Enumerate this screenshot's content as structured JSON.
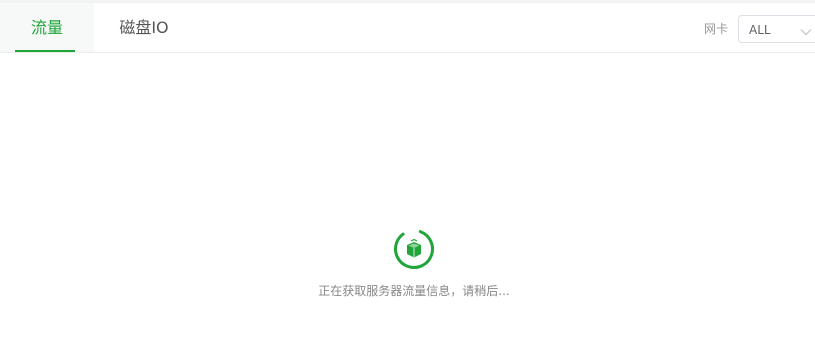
{
  "tabs": [
    {
      "label": "流量",
      "active": true
    },
    {
      "label": "磁盘IO",
      "active": false
    }
  ],
  "nic_filter": {
    "label": "网卡",
    "selected": "ALL",
    "icon": "chevron-down-icon"
  },
  "loading": {
    "icon": "server-loading-icon",
    "message": "正在获取服务器流量信息，请稍后..."
  },
  "colors": {
    "accent": "#20a53a",
    "tab_active_bg": "#f7f8f8",
    "muted_text": "#888888"
  }
}
